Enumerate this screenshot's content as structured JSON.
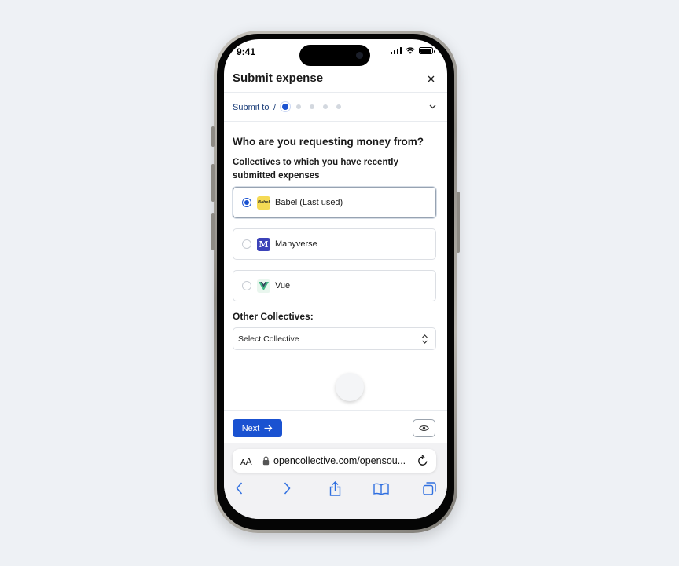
{
  "status_bar": {
    "time": "9:41"
  },
  "modal": {
    "title": "Submit expense",
    "close_icon": "close-icon"
  },
  "stepper": {
    "label": "Submit to",
    "separator": "/",
    "total_steps": 5,
    "current_step": 1
  },
  "form": {
    "question": "Who are you requesting money from?",
    "recent_label": "Collectives to which you have recently submitted expenses",
    "options": [
      {
        "label": "Babel (Last used)",
        "logo_text": "Babel",
        "selected": true
      },
      {
        "label": "Manyverse",
        "logo_text": "M",
        "selected": false
      },
      {
        "label": "Vue",
        "logo_text": "",
        "selected": false
      }
    ],
    "other_label": "Other Collectives:",
    "select": {
      "value": "Select Collective"
    }
  },
  "footer": {
    "next_label": "Next",
    "next_icon": "arrow-right-icon",
    "preview_icon": "eye-icon"
  },
  "browser": {
    "text_size_small": "A",
    "text_size_large": "A",
    "url": "opencollective.com/opensou...",
    "toolbar_icons": [
      "back-icon",
      "forward-icon",
      "share-icon",
      "bookmarks-icon",
      "tabs-icon"
    ]
  },
  "colors": {
    "primary": "#1a52d1",
    "stepper_text": "#1d3f7a",
    "babel_logo": "#f5da55",
    "manyverse_logo": "#3c43b9",
    "vue_green": "#41b883",
    "vue_dark": "#34495e",
    "background": "#eef1f5"
  }
}
